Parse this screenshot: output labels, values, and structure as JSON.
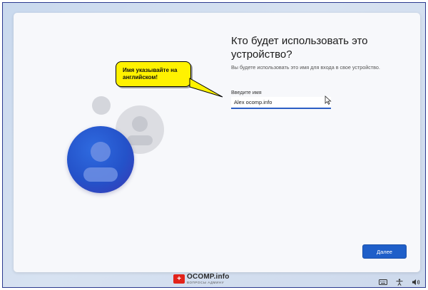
{
  "setup": {
    "title": "Кто будет использовать это устройство?",
    "subtitle": "Вы будете использовать это имя для входа в свое устройство.",
    "name_label": "Введите имя",
    "name_value": "Alex ocomp.info",
    "next_label": "Далее"
  },
  "annotation": {
    "text": "Имя указывайте на английском!"
  },
  "watermark": {
    "title": "OCOMP.info",
    "subtitle": "ВОПРОСЫ АДМИНУ"
  },
  "tray": {
    "icons": [
      "keyboard-icon",
      "accessibility-icon",
      "volume-icon"
    ]
  },
  "colors": {
    "accent": "#1f5fc9",
    "callout": "#fff200",
    "background": "#d7e2f1"
  }
}
